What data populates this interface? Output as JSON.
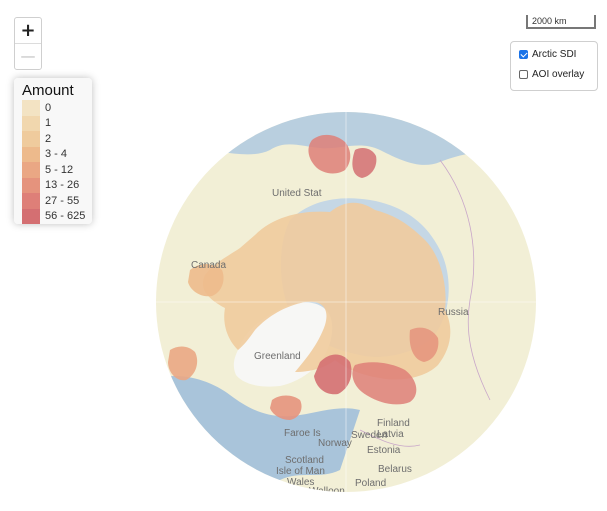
{
  "zoom": {
    "in_label": "+",
    "out_label": "—"
  },
  "legend": {
    "title": "Amount",
    "items": [
      {
        "label": "0",
        "color": "#f3e3c3"
      },
      {
        "label": "1",
        "color": "#f1d7ae"
      },
      {
        "label": "2",
        "color": "#efcb9d"
      },
      {
        "label": "3 - 4",
        "color": "#edba8c"
      },
      {
        "label": "5 - 12",
        "color": "#eaa784"
      },
      {
        "label": "13 - 26",
        "color": "#e5937d"
      },
      {
        "label": "27 - 55",
        "color": "#de7f78"
      },
      {
        "label": "56 - 625",
        "color": "#d46f72"
      }
    ]
  },
  "scale": {
    "label": "2000 km"
  },
  "layers": [
    {
      "label": "Arctic SDI",
      "checked": true
    },
    {
      "label": "AOI overlay",
      "checked": false
    }
  ],
  "map": {
    "labels": {
      "united_states": "United Stat",
      "canada": "Canada",
      "greenland": "Greenland",
      "russia": "Russia",
      "faroe_is": "Faroe Is",
      "norway": "Norway",
      "sweden": "Sweden",
      "finland": "Finland",
      "latvia": "Latvia",
      "estonia": "Estonia",
      "belarus": "Belarus",
      "scotland": "Scotland",
      "isle_of_man": "Isle of Man",
      "wales": "Wales",
      "walloon": "Walloon",
      "poland": "Poland"
    }
  }
}
